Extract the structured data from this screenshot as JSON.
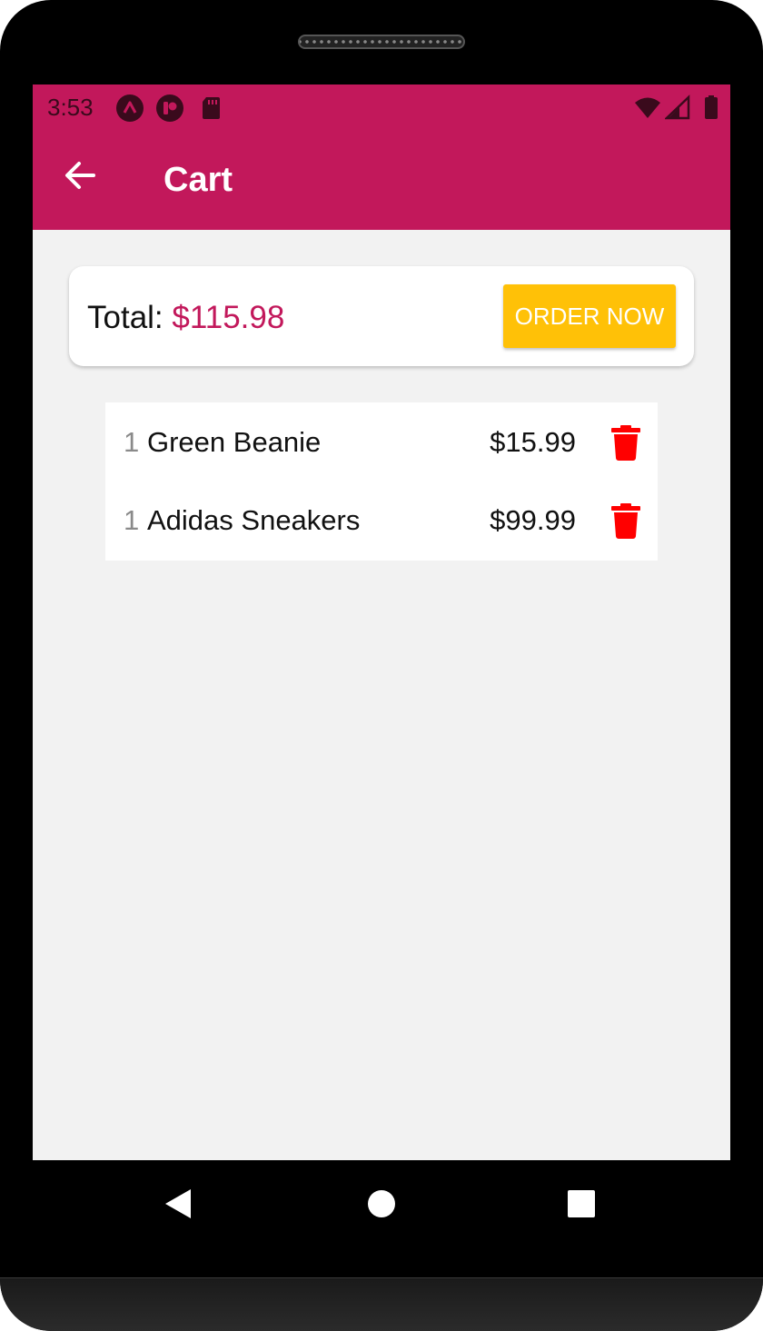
{
  "status_bar": {
    "time": "3:53",
    "left_icons": [
      "app-a-icon",
      "app-p-icon",
      "sd-card-icon"
    ],
    "right_icons": [
      "wifi-icon",
      "signal-icon",
      "battery-icon"
    ]
  },
  "app_bar": {
    "title": "Cart",
    "back_icon": "arrow-back-icon",
    "color": "#c2185b"
  },
  "total_card": {
    "label": "Total:",
    "amount": "$115.98",
    "amount_color": "#c2185b",
    "order_button_label": "ORDER NOW",
    "order_button_color": "#ffc107"
  },
  "cart_items": [
    {
      "quantity": "1",
      "name": "Green Beanie",
      "price": "$15.99",
      "delete_icon": "trash-icon"
    },
    {
      "quantity": "1",
      "name": "Adidas Sneakers",
      "price": "$99.99",
      "delete_icon": "trash-icon"
    }
  ],
  "delete_icon_color": "#ff0000",
  "nav_bar": {
    "buttons": [
      "back-triangle-icon",
      "home-circle-icon",
      "recents-square-icon"
    ]
  }
}
